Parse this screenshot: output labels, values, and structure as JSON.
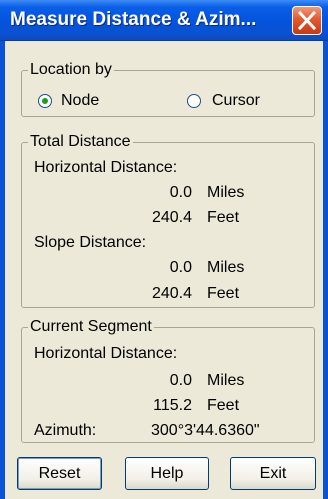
{
  "window": {
    "title": "Measure Distance & Azim..."
  },
  "location_by": {
    "legend": "Location by",
    "options": [
      {
        "label": "Node",
        "selected": true
      },
      {
        "label": "Cursor",
        "selected": false
      }
    ]
  },
  "total_distance": {
    "legend": "Total Distance",
    "horizontal": {
      "label": "Horizontal Distance:",
      "miles": "0.0",
      "feet": "240.4"
    },
    "slope": {
      "label": "Slope Distance:",
      "miles": "0.0",
      "feet": "240.4"
    }
  },
  "current_segment": {
    "legend": "Current Segment",
    "horizontal": {
      "label": "Horizontal Distance:",
      "miles": "0.0",
      "feet": "115.2"
    },
    "azimuth": {
      "label": "Azimuth:",
      "value": "300°3'44.6360\""
    }
  },
  "units": {
    "miles": "Miles",
    "feet": "Feet"
  },
  "buttons": {
    "reset": "Reset",
    "help": "Help",
    "exit": "Exit"
  },
  "colors": {
    "titlebar": "#0453dc",
    "close": "#e2592f",
    "dialog_bg": "#ece9d8",
    "radio_dot": "#1f9b1f"
  }
}
